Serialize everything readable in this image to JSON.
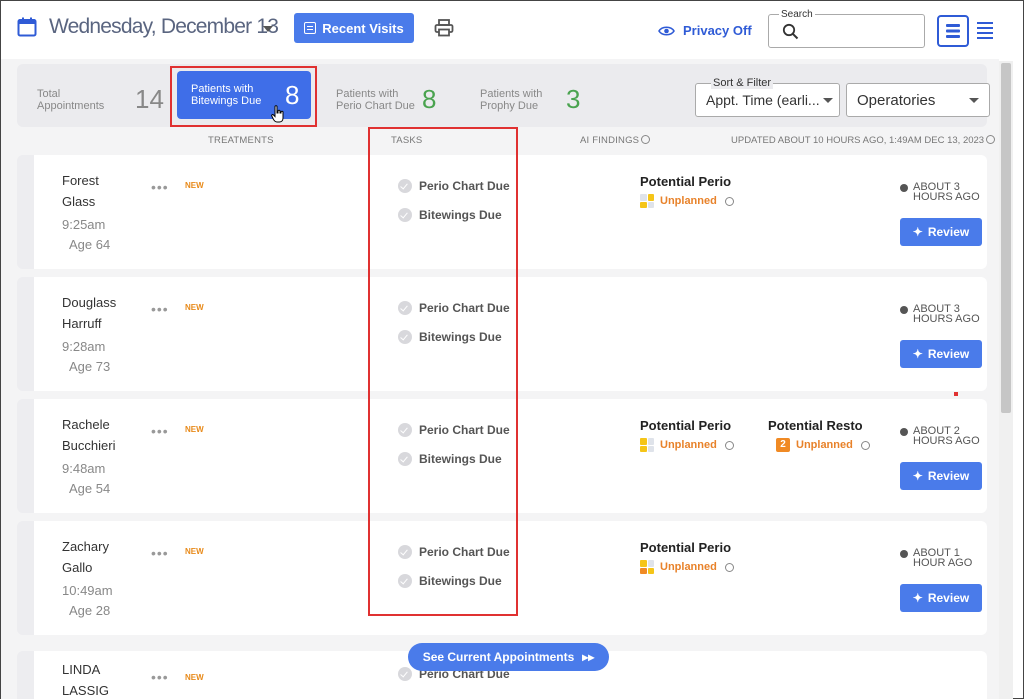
{
  "header": {
    "date": "Wednesday, December 13",
    "recent_visits": "Recent Visits",
    "privacy": "Privacy Off",
    "search_label": "Search",
    "search_placeholder": ""
  },
  "stats": {
    "total_label": "Total Appointments",
    "total_value": "14",
    "bitewings_label": "Patients with Bitewings Due",
    "bitewings_value": "8",
    "perio_label": "Patients with Perio Chart Due",
    "perio_value": "8",
    "prophy_label": "Patients with Prophy Due",
    "prophy_value": "3"
  },
  "filters": {
    "sort_label": "Sort & Filter",
    "sort_value": "Appt. Time (earli...",
    "operatories_value": "Operatories"
  },
  "columns": {
    "treatments": "TREATMENTS",
    "tasks": "TASKS",
    "ai_findings": "AI FINDINGS",
    "updated": "UPDATED ABOUT 10 HOURS AGO, 1:49AM DEC 13, 2023"
  },
  "patients": [
    {
      "first": "Forest",
      "last": "Glass",
      "time": "9:25am",
      "age": "Age 64",
      "new": "NEW",
      "task1": "Perio Chart Due",
      "task2": "Bitewings Due",
      "f1_title": "Potential Perio",
      "f1_status": "Unplanned",
      "ago1": "ABOUT 3",
      "ago2": "HOURS AGO",
      "review": "Review"
    },
    {
      "first": "Douglass",
      "last": "Harruff",
      "time": "9:28am",
      "age": "Age 73",
      "new": "NEW",
      "task1": "Perio Chart Due",
      "task2": "Bitewings Due",
      "ago1": "ABOUT 3",
      "ago2": "HOURS AGO",
      "review": "Review"
    },
    {
      "first": "Rachele",
      "last": "Bucchieri",
      "time": "9:48am",
      "age": "Age 54",
      "new": "NEW",
      "task1": "Perio Chart Due",
      "task2": "Bitewings Due",
      "f1_title": "Potential Perio",
      "f1_status": "Unplanned",
      "f2_title": "Potential Resto",
      "f2_count": "2",
      "f2_status": "Unplanned",
      "ago1": "ABOUT 2",
      "ago2": "HOURS AGO",
      "review": "Review"
    },
    {
      "first": "Zachary",
      "last": "Gallo",
      "time": "10:49am",
      "age": "Age 28",
      "new": "NEW",
      "task1": "Perio Chart Due",
      "task2": "Bitewings Due",
      "f1_title": "Potential Perio",
      "f1_status": "Unplanned",
      "ago1": "ABOUT 1",
      "ago2": "HOUR AGO",
      "review": "Review"
    },
    {
      "first": "LINDA",
      "last": "LASSIG",
      "new": "NEW",
      "task1": "Perio Chart Due"
    }
  ],
  "see_current": "See Current Appointments"
}
